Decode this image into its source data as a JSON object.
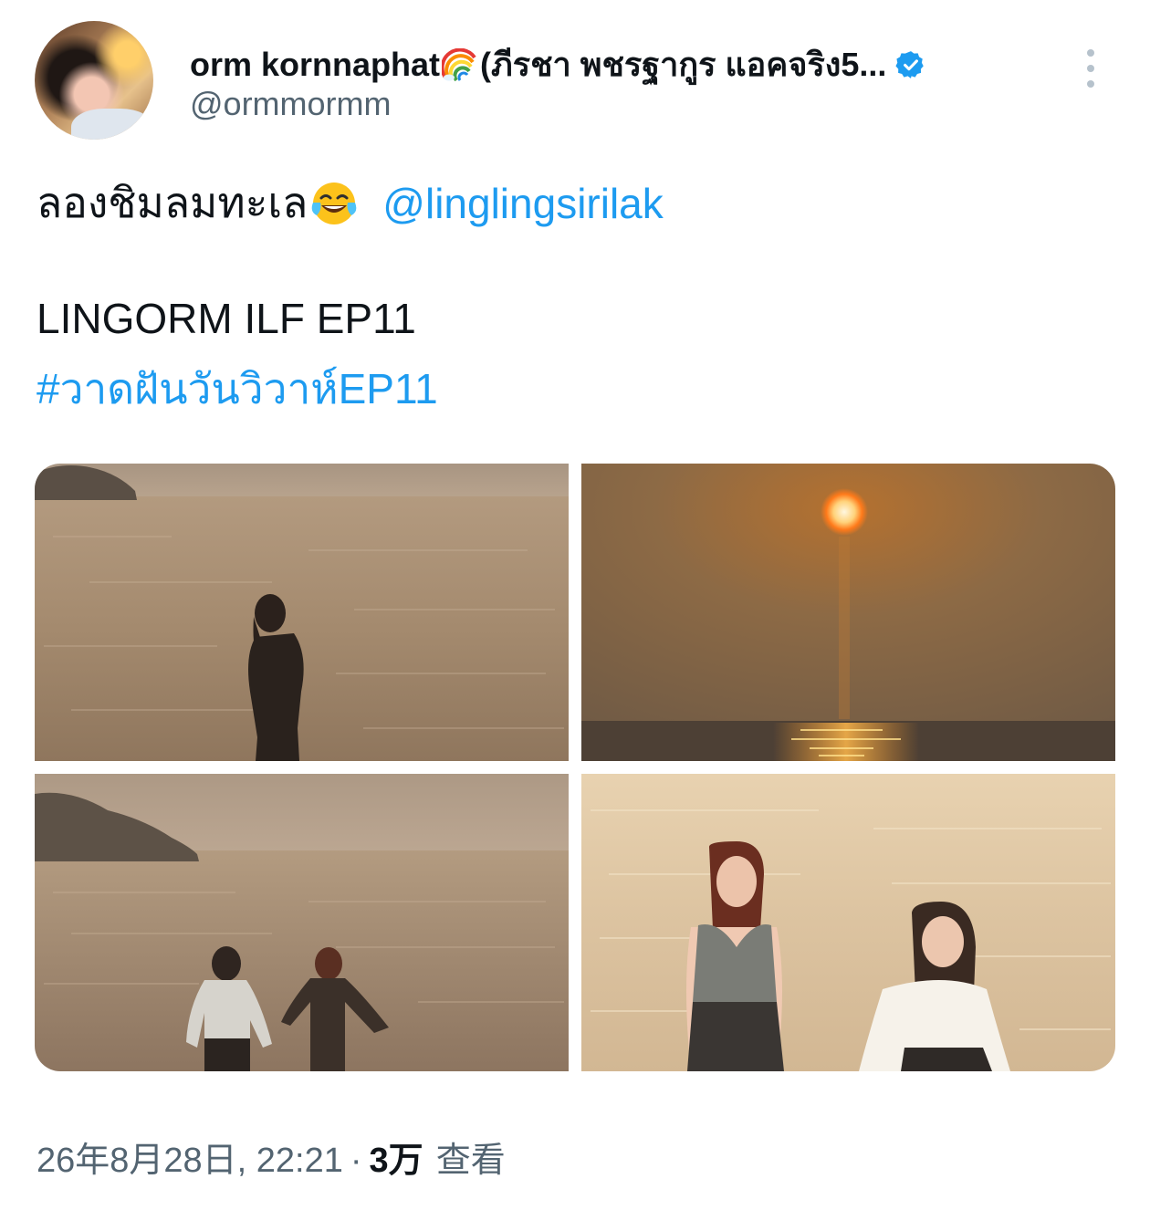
{
  "author": {
    "display_name_prefix": "orm kornnaphat",
    "display_name_suffix": "(ภีรชา พชรฐากูร แอคจริง5...",
    "rainbow_icon": "rainbow-emoji",
    "verified_icon": "verified-badge-icon",
    "handle": "@ormmormm"
  },
  "tweet": {
    "text_thai": "ลองชิมลมทะเล",
    "emoji": "face-with-tears-of-joy-emoji",
    "mention": "@linglingsirilak",
    "line2": "LINGORM ILF EP11",
    "hashtag": "#วาดฝันวันวิวาห์EP11"
  },
  "media": [
    {
      "name": "photo-silhouette-woman-sea",
      "description_icon": "image"
    },
    {
      "name": "photo-sunset-over-sea",
      "description_icon": "image"
    },
    {
      "name": "photo-two-women-silhouette-beach",
      "description_icon": "image"
    },
    {
      "name": "photo-two-women-laughing-sea",
      "description_icon": "image"
    }
  ],
  "footer": {
    "timestamp": "26年8月28日, 22:21",
    "separator": "·",
    "views_count": "3万",
    "views_label": "查看"
  },
  "colors": {
    "link": "#1d9bf0",
    "secondary_text": "#536471",
    "primary_text": "#0f1419",
    "verified": "#1d9bf0"
  }
}
